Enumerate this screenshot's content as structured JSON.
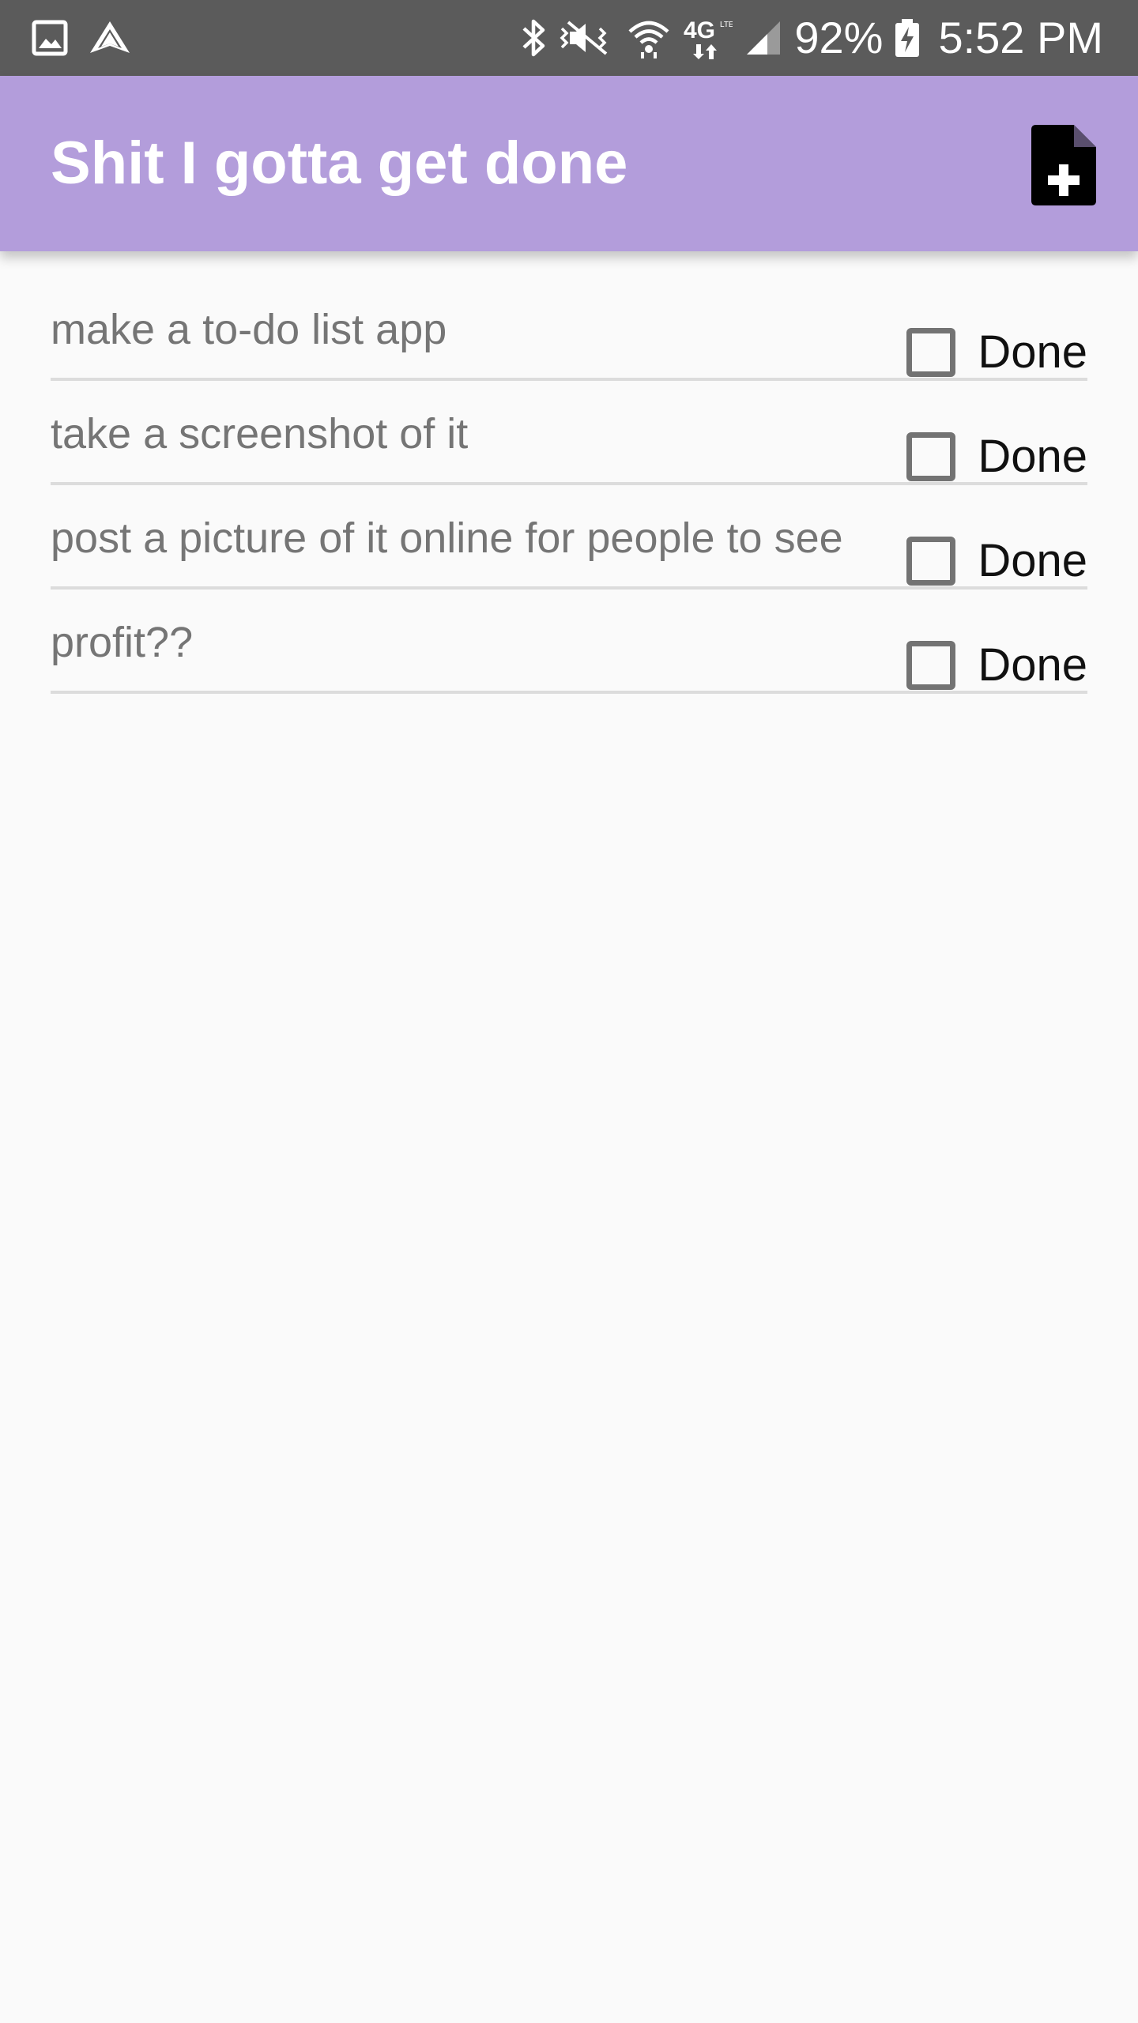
{
  "status_bar": {
    "left_icons": [
      "image-icon",
      "navigation-icon"
    ],
    "right_icons": [
      "bluetooth-icon",
      "vibrate-mute-icon",
      "wifi-icon",
      "4g-lte-icon",
      "cellular-signal-icon",
      "battery-charging-icon"
    ],
    "battery": "92%",
    "time": "5:52 PM",
    "network_label": "4G"
  },
  "app_bar": {
    "title": "Shit I gotta get done",
    "color": "#b39ddb",
    "action_icon": "note-add-icon"
  },
  "todos": [
    {
      "text": "make a to-do list app",
      "done_label": "Done",
      "checked": false
    },
    {
      "text": "take a screenshot of it",
      "done_label": "Done",
      "checked": false
    },
    {
      "text": "post a picture of it online for people to see",
      "done_label": "Done",
      "checked": false
    },
    {
      "text": "profit??",
      "done_label": "Done",
      "checked": false
    }
  ]
}
